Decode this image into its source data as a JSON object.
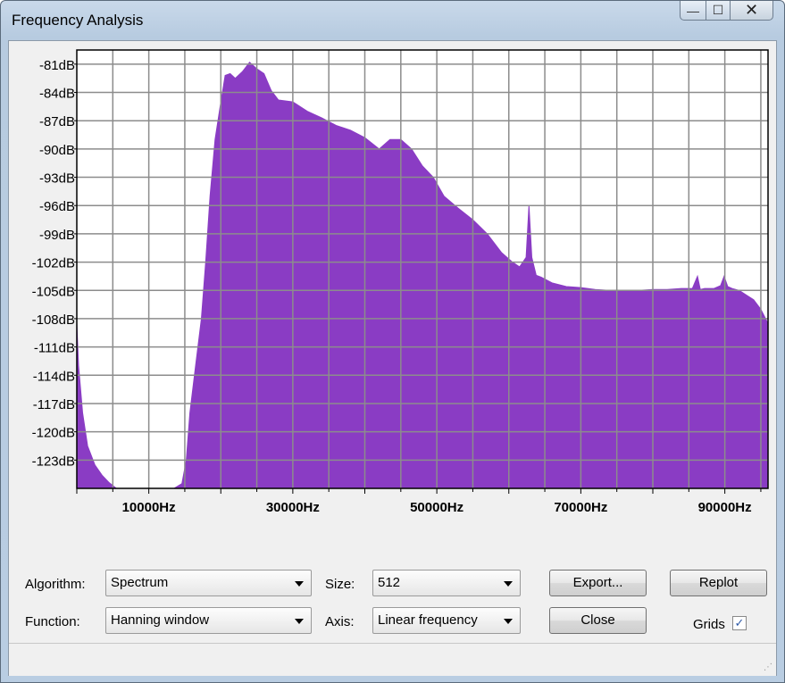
{
  "window": {
    "title": "Frequency Analysis",
    "controls": {
      "minimize": "—",
      "maximize": "☐",
      "close": "✕"
    }
  },
  "chart_data": {
    "type": "area",
    "fill_color": "#8a3cc4",
    "grid": true,
    "x_unit": "Hz",
    "y_unit": "dB",
    "xlim": [
      0,
      96000
    ],
    "ylim": [
      -126,
      -79.5
    ],
    "x_ticks": [
      10000,
      30000,
      50000,
      70000,
      90000
    ],
    "x_tick_labels": [
      "10000Hz",
      "30000Hz",
      "50000Hz",
      "70000Hz",
      "90000Hz"
    ],
    "y_ticks": [
      -81,
      -84,
      -87,
      -90,
      -93,
      -96,
      -99,
      -102,
      -105,
      -108,
      -111,
      -114,
      -117,
      -120,
      -123
    ],
    "y_tick_labels": [
      "-81dB",
      "-84dB",
      "-87dB",
      "-90dB",
      "-93dB",
      "-96dB",
      "-99dB",
      "-102dB",
      "-105dB",
      "-108dB",
      "-111dB",
      "-114dB",
      "-117dB",
      "-120dB",
      "-123dB"
    ],
    "x": [
      0,
      250,
      800,
      1500,
      2500,
      3500,
      4500,
      5500,
      8000,
      11000,
      13500,
      14600,
      15200,
      15700,
      16500,
      17300,
      17900,
      18500,
      19200,
      20000,
      20600,
      21300,
      22000,
      23000,
      24000,
      25000,
      26000,
      27000,
      28000,
      30000,
      32000,
      34000,
      36000,
      38000,
      40000,
      42000,
      43500,
      45000,
      46500,
      48000,
      49500,
      51000,
      53000,
      55000,
      57000,
      59000,
      60500,
      61500,
      62400,
      62800,
      63200,
      63800,
      64500,
      66000,
      68000,
      70000,
      72000,
      74000,
      76000,
      78000,
      80000,
      82000,
      84000,
      85500,
      86200,
      86600,
      87200,
      88500,
      89400,
      89900,
      90400,
      91000,
      92000,
      93000,
      94000,
      95000,
      96000
    ],
    "y": [
      -108.5,
      -113,
      -118,
      -121.5,
      -123.5,
      -124.6,
      -125.4,
      -126,
      -126,
      -126,
      -126,
      -125.5,
      -123,
      -118,
      -113,
      -108,
      -102,
      -95,
      -89,
      -85,
      -82.2,
      -82,
      -82.5,
      -81.8,
      -80.8,
      -81.5,
      -82,
      -83.8,
      -84.8,
      -85,
      -86,
      -86.7,
      -87.5,
      -88,
      -88.8,
      -90,
      -89,
      -89,
      -90,
      -91.8,
      -93,
      -95,
      -96.3,
      -97.5,
      -99,
      -101,
      -102,
      -102.5,
      -101.5,
      -96,
      -101.5,
      -103.4,
      -103.6,
      -104.2,
      -104.6,
      -104.7,
      -104.9,
      -105,
      -105,
      -105,
      -104.9,
      -104.9,
      -104.8,
      -104.8,
      -103.5,
      -104.9,
      -104.8,
      -104.8,
      -104.5,
      -103.5,
      -104.6,
      -104.8,
      -105,
      -105.5,
      -106,
      -107,
      -108.5
    ]
  },
  "controls": {
    "algorithm_label": "Algorithm:",
    "algorithm_value": "Spectrum",
    "function_label": "Function:",
    "function_value": "Hanning window",
    "size_label": "Size:",
    "size_value": "512",
    "axis_label": "Axis:",
    "axis_value": "Linear frequency",
    "export_label": "Export...",
    "replot_label": "Replot",
    "close_label": "Close",
    "grids_label": "Grids",
    "grids_checked": true,
    "grids_check_glyph": "✓"
  }
}
